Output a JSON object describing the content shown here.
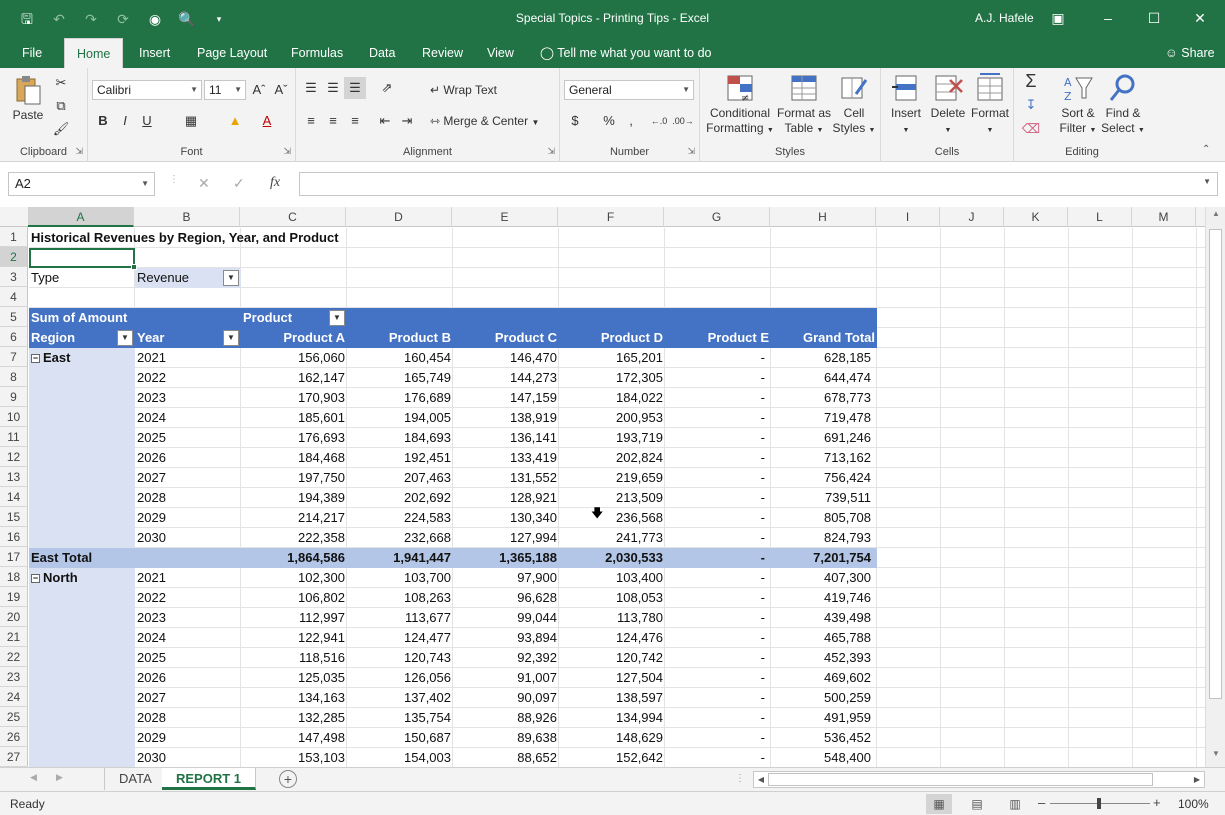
{
  "window": {
    "title": "Special Topics - Printing Tips  -  Excel",
    "user": "A.J. Hafele",
    "accent": "#217346"
  },
  "ribbon_tabs": [
    "File",
    "Home",
    "Insert",
    "Page Layout",
    "Formulas",
    "Data",
    "Review",
    "View"
  ],
  "active_tab": "Home",
  "tell_me": "Tell me what you want to do",
  "share": "Share",
  "ribbon": {
    "clipboard": {
      "label": "Clipboard",
      "paste": "Paste"
    },
    "font": {
      "label": "Font",
      "name": "Calibri",
      "size": "11",
      "bold": "B",
      "italic": "I",
      "underline": "U"
    },
    "alignment": {
      "label": "Alignment",
      "wrap": "Wrap Text",
      "merge": "Merge & Center"
    },
    "number": {
      "label": "Number",
      "format": "General",
      "currency": "$",
      "percent": "%",
      "comma": ","
    },
    "styles": {
      "label": "Styles",
      "conditional_1": "Conditional",
      "conditional_2": "Formatting",
      "table_1": "Format as",
      "table_2": "Table",
      "cell_1": "Cell",
      "cell_2": "Styles"
    },
    "cells": {
      "label": "Cells",
      "insert": "Insert",
      "delete": "Delete",
      "format": "Format"
    },
    "editing": {
      "label": "Editing",
      "sort_1": "Sort &",
      "sort_2": "Filter",
      "find_1": "Find &",
      "find_2": "Select"
    }
  },
  "formula_bar": {
    "name_box": "A2",
    "fx": "fx",
    "value": ""
  },
  "columns": [
    "A",
    "B",
    "C",
    "D",
    "E",
    "F",
    "G",
    "H",
    "I",
    "J",
    "K",
    "L",
    "M"
  ],
  "selected_column": "A",
  "row_numbers": [
    "1",
    "2",
    "3",
    "4",
    "5",
    "6",
    "7",
    "8",
    "9",
    "10",
    "11",
    "12",
    "13",
    "14",
    "15",
    "16",
    "17",
    "18",
    "19",
    "20",
    "21",
    "22",
    "23",
    "24",
    "25",
    "26",
    "27"
  ],
  "selected_row": "2",
  "sheet": {
    "title": "Historical Revenues by Region, Year, and Product",
    "filter_label": "Type",
    "filter_value": "Revenue",
    "values_label": "Sum of Amount",
    "columns_label": "Product",
    "row_header_1": "Region",
    "row_header_2": "Year",
    "product_headers": [
      "Product A",
      "Product B",
      "Product C",
      "Product D",
      "Product E",
      "Grand Total"
    ],
    "groups": [
      {
        "region": "East",
        "rows": [
          [
            "2021",
            "156,060",
            "160,454",
            "146,470",
            "165,201",
            "-",
            "628,185"
          ],
          [
            "2022",
            "162,147",
            "165,749",
            "144,273",
            "172,305",
            "-",
            "644,474"
          ],
          [
            "2023",
            "170,903",
            "176,689",
            "147,159",
            "184,022",
            "-",
            "678,773"
          ],
          [
            "2024",
            "185,601",
            "194,005",
            "138,919",
            "200,953",
            "-",
            "719,478"
          ],
          [
            "2025",
            "176,693",
            "184,693",
            "136,141",
            "193,719",
            "-",
            "691,246"
          ],
          [
            "2026",
            "184,468",
            "192,451",
            "133,419",
            "202,824",
            "-",
            "713,162"
          ],
          [
            "2027",
            "197,750",
            "207,463",
            "131,552",
            "219,659",
            "-",
            "756,424"
          ],
          [
            "2028",
            "194,389",
            "202,692",
            "128,921",
            "213,509",
            "-",
            "739,511"
          ],
          [
            "2029",
            "214,217",
            "224,583",
            "130,340",
            "236,568",
            "-",
            "805,708"
          ],
          [
            "2030",
            "222,358",
            "232,668",
            "127,994",
            "241,773",
            "-",
            "824,793"
          ]
        ],
        "total_label": "East Total",
        "total": [
          "1,864,586",
          "1,941,447",
          "1,365,188",
          "2,030,533",
          "-",
          "7,201,754"
        ]
      },
      {
        "region": "North",
        "rows": [
          [
            "2021",
            "102,300",
            "103,700",
            "97,900",
            "103,400",
            "-",
            "407,300"
          ],
          [
            "2022",
            "106,802",
            "108,263",
            "96,628",
            "108,053",
            "-",
            "419,746"
          ],
          [
            "2023",
            "112,997",
            "113,677",
            "99,044",
            "113,780",
            "-",
            "439,498"
          ],
          [
            "2024",
            "122,941",
            "124,477",
            "93,894",
            "124,476",
            "-",
            "465,788"
          ],
          [
            "2025",
            "118,516",
            "120,743",
            "92,392",
            "120,742",
            "-",
            "452,393"
          ],
          [
            "2026",
            "125,035",
            "126,056",
            "91,007",
            "127,504",
            "-",
            "469,602"
          ],
          [
            "2027",
            "134,163",
            "137,402",
            "90,097",
            "138,597",
            "-",
            "500,259"
          ],
          [
            "2028",
            "132,285",
            "135,754",
            "88,926",
            "134,994",
            "-",
            "491,959"
          ],
          [
            "2029",
            "147,498",
            "150,687",
            "89,638",
            "148,629",
            "-",
            "536,452"
          ],
          [
            "2030",
            "153,103",
            "154,003",
            "88,652",
            "152,642",
            "-",
            "548,400"
          ]
        ]
      }
    ]
  },
  "sheet_tabs": [
    "DATA",
    "REPORT 1"
  ],
  "active_sheet": "REPORT 1",
  "status": "Ready",
  "zoom": "100%"
}
